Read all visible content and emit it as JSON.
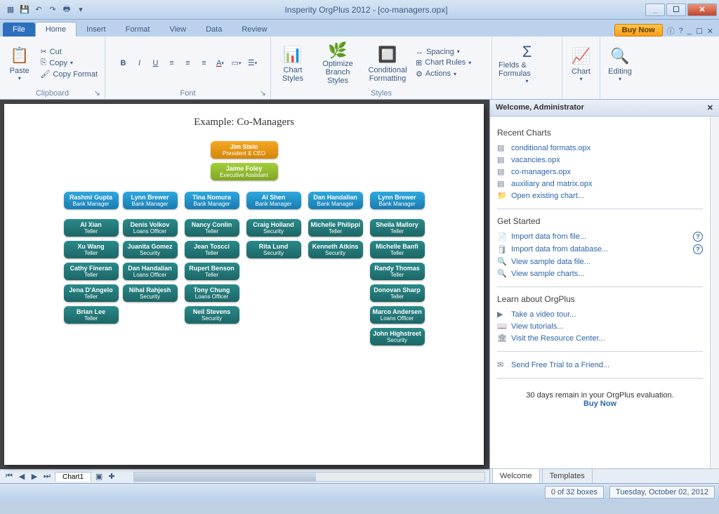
{
  "title": "Insperity OrgPlus 2012 - [co-managers.opx]",
  "qat_icons": [
    "app",
    "save",
    "undo",
    "redo",
    "print"
  ],
  "tabs": {
    "file": "File",
    "list": [
      "Home",
      "Insert",
      "Format",
      "View",
      "Data",
      "Review"
    ],
    "active": "Home"
  },
  "buynow": "Buy Now",
  "ribbon": {
    "clipboard": {
      "label": "Clipboard",
      "paste": "Paste",
      "cut": "Cut",
      "copy": "Copy",
      "format": "Copy Format"
    },
    "font": {
      "label": "Font"
    },
    "styles": {
      "label": "Styles",
      "chartstyles": "Chart Styles",
      "optimize": "Optimize\nBranch Styles",
      "cond": "Conditional\nFormatting",
      "spacing": "Spacing",
      "rules": "Chart Rules",
      "actions": "Actions"
    },
    "ff": {
      "label": "Fields & Formulas"
    },
    "chart": {
      "label": "Chart"
    },
    "editing": {
      "label": "Editing"
    }
  },
  "chart": {
    "title": "Example: Co-Managers",
    "ceo": {
      "name": "Jim Stein",
      "title": "President & CEO"
    },
    "ea": {
      "name": "Jaime Foley",
      "title": "Executive Assistant"
    },
    "managers": [
      {
        "name": "Rashmi Gupta",
        "title": "Bank Manager",
        "subs": [
          {
            "name": "Al Xian",
            "title": "Teller"
          },
          {
            "name": "Xu Wang",
            "title": "Teller"
          },
          {
            "name": "Cathy Fineran",
            "title": "Teller"
          },
          {
            "name": "Jena D'Angelo",
            "title": "Teller"
          },
          {
            "name": "Brian Lee",
            "title": "Teller"
          }
        ]
      },
      {
        "name": "Lynn Brewer",
        "title": "Bank Manager",
        "subs": [
          {
            "name": "Denis Volkov",
            "title": "Loans Officer"
          },
          {
            "name": "Juanita Gomez",
            "title": "Security"
          },
          {
            "name": "Dan Handalian",
            "title": "Loans Officer"
          },
          {
            "name": "Nihal Rahjesh",
            "title": "Security"
          }
        ]
      },
      {
        "name": "Tina Nomura",
        "title": "Bank Manager",
        "subs": [
          {
            "name": "Nancy Conlin",
            "title": "Teller"
          },
          {
            "name": "Jean Toscci",
            "title": "Teller"
          },
          {
            "name": "Rupert Benson",
            "title": "Teller"
          },
          {
            "name": "Tony Chung",
            "title": "Loans Officer"
          },
          {
            "name": "Neil Stevens",
            "title": "Security"
          }
        ]
      },
      {
        "name": "Al Shen",
        "title": "Bank Manager",
        "subs": [
          {
            "name": "Craig Holland",
            "title": "Security"
          },
          {
            "name": "Rita Lund",
            "title": "Security"
          }
        ]
      },
      {
        "name": "Dan Handalian",
        "title": "Bank Manager",
        "subs": [
          {
            "name": "Michelle Philippi",
            "title": "Teller"
          },
          {
            "name": "Kenneth Atkins",
            "title": "Security"
          }
        ]
      },
      {
        "name": "Lynn Brewer",
        "title": "Bank Manager",
        "subs": [
          {
            "name": "Sheila Mallory",
            "title": "Teller"
          },
          {
            "name": "Michelle Banfi",
            "title": "Teller"
          },
          {
            "name": "Randy Thomas",
            "title": "Teller"
          },
          {
            "name": "Donovan Sharp",
            "title": "Teller"
          },
          {
            "name": "Marco Andersen",
            "title": "Loans Officer"
          },
          {
            "name": "John Highstreet",
            "title": "Security"
          }
        ]
      }
    ],
    "tab": "Chart1"
  },
  "side": {
    "header": "Welcome, Administrator",
    "recent": {
      "h": "Recent Charts",
      "items": [
        "conditional formats.opx",
        "vacancies.opx",
        "co-managers.opx",
        "auxiliary and matrix.opx"
      ],
      "open": "Open existing chart..."
    },
    "started": {
      "h": "Get Started",
      "items": [
        "Import data from file...",
        "Import data from database...",
        "View sample data file...",
        "View sample charts..."
      ]
    },
    "learn": {
      "h": "Learn about OrgPlus",
      "items": [
        "Take a video tour...",
        "View tutorials...",
        "Visit the Resource Center..."
      ]
    },
    "send": "Send Free Trial to a Friend...",
    "trial": {
      "text": "30 days remain in your OrgPlus evaluation.",
      "link": "Buy Now"
    },
    "tabs": [
      "Welcome",
      "Templates"
    ]
  },
  "status": {
    "boxes": "0 of 32 boxes",
    "date": "Tuesday, October 02, 2012"
  }
}
